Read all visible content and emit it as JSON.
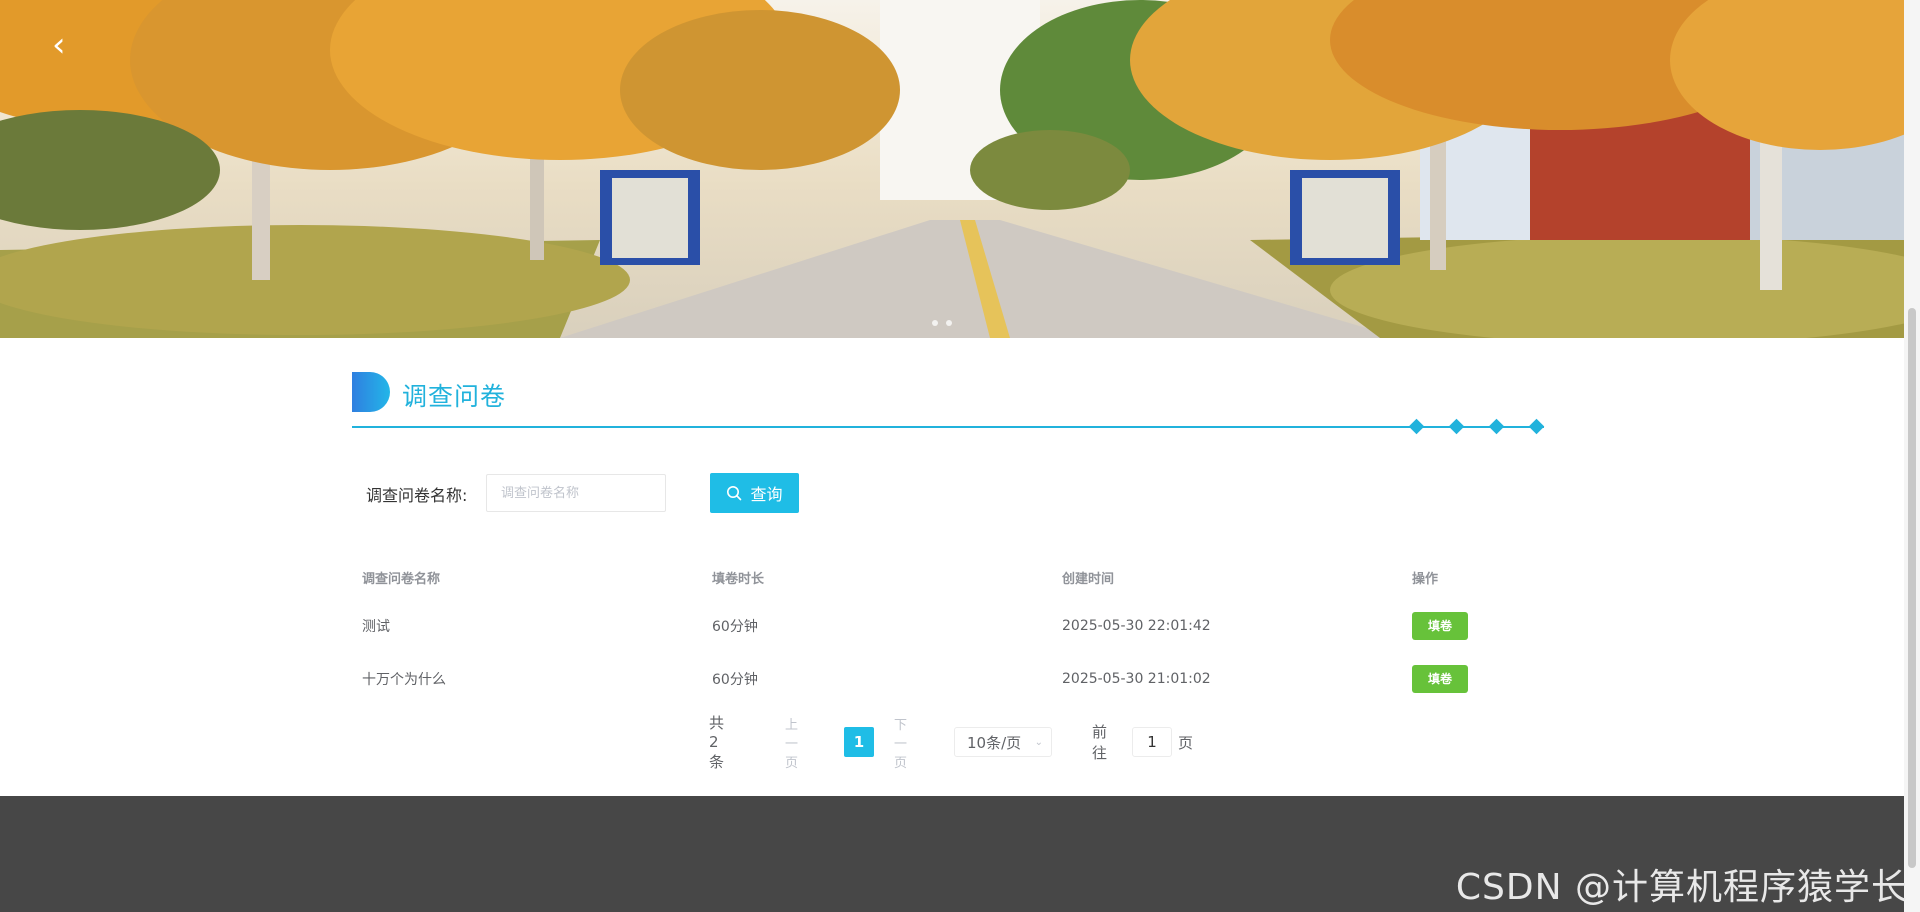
{
  "banner": {
    "prev_arrow": "‹",
    "dots": 2
  },
  "section": {
    "title": "调查问卷"
  },
  "search": {
    "label": "调查问卷名称:",
    "placeholder": "调查问卷名称",
    "value": "",
    "button_label": "查询",
    "button_icon": "search-icon"
  },
  "table": {
    "headers": [
      "调查问卷名称",
      "填卷时长",
      "创建时间",
      "操作"
    ],
    "rows": [
      {
        "name": "测试",
        "duration": "60分钟",
        "created": "2025-05-30 22:01:42",
        "action": "填卷"
      },
      {
        "name": "十万个为什么",
        "duration": "60分钟",
        "created": "2025-05-30 21:01:02",
        "action": "填卷"
      }
    ]
  },
  "pagination": {
    "total": "共 2 条",
    "prev": "上一页",
    "current": "1",
    "next": "下一页",
    "page_size": "10条/页",
    "goto_label": "前往",
    "goto_value": "1",
    "page_suffix": "页"
  },
  "watermark": "CSDN @计算机程序猿学长",
  "colors": {
    "accent": "#1fbde6",
    "title": "#21b2dc",
    "fill_button": "#67c23a",
    "footer": "#474747"
  }
}
